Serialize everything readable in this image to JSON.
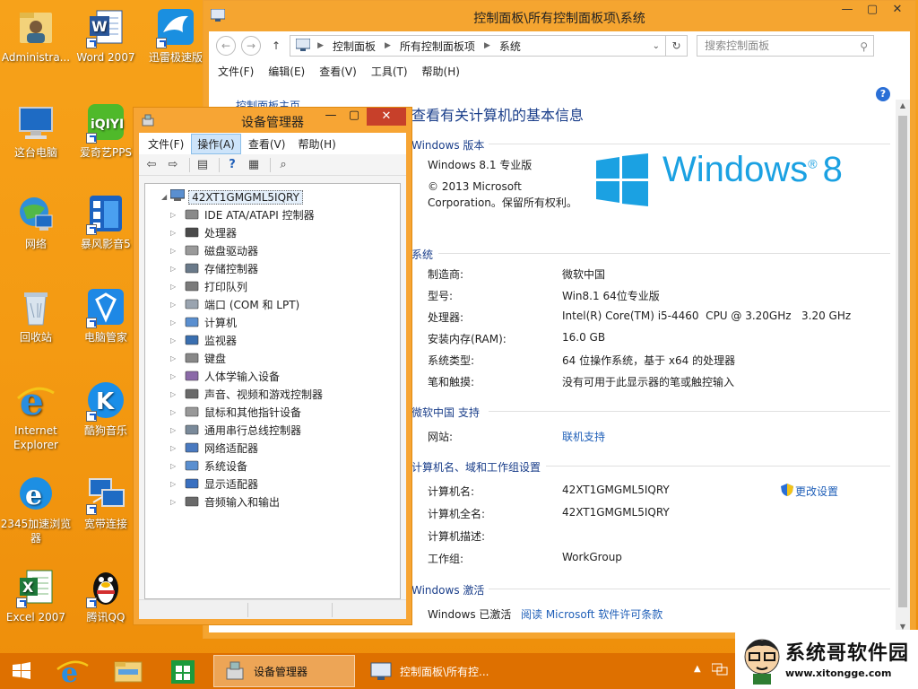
{
  "desktop": {
    "icons": [
      {
        "label": "Administra..."
      },
      {
        "label": "Word 2007"
      },
      {
        "label": "迅雷极速版"
      },
      {
        "label": "这台电脑"
      },
      {
        "label": "爱奇艺PPS"
      },
      {
        "label": "网络"
      },
      {
        "label": "暴风影音5"
      },
      {
        "label": "回收站"
      },
      {
        "label": "电脑管家"
      },
      {
        "label": "Internet Explorer"
      },
      {
        "label": "酷狗音乐"
      },
      {
        "label": "2345加速浏览器"
      },
      {
        "label": "宽带连接"
      },
      {
        "label": "Excel 2007"
      },
      {
        "label": "腾讯QQ"
      }
    ]
  },
  "control_panel": {
    "title": "控制面板\\所有控制面板项\\系统",
    "breadcrumbs": [
      "控制面板",
      "所有控制面板项",
      "系统"
    ],
    "search_placeholder": "搜索控制面板",
    "menu": [
      "文件(F)",
      "编辑(E)",
      "查看(V)",
      "工具(T)",
      "帮助(H)"
    ],
    "left_link": "控制面板主页",
    "heading": "查看有关计算机的基本信息",
    "edition": {
      "section": "Windows 版本",
      "name": "Windows 8.1 专业版",
      "copyright": "© 2013 Microsoft Corporation。保留所有权利。",
      "logo_text": "Windows",
      "logo_num": "8"
    },
    "system": {
      "section": "系统",
      "rows": [
        {
          "k": "制造商:",
          "v": "微软中国"
        },
        {
          "k": "型号:",
          "v": "Win8.1 64位专业版"
        },
        {
          "k": "处理器:",
          "v": "Intel(R) Core(TM) i5-4460  CPU @ 3.20GHz   3.20 GHz"
        },
        {
          "k": "安装内存(RAM):",
          "v": "16.0 GB"
        },
        {
          "k": "系统类型:",
          "v": "64 位操作系统，基于 x64 的处理器"
        },
        {
          "k": "笔和触摸:",
          "v": "没有可用于此显示器的笔或触控输入"
        }
      ]
    },
    "support": {
      "section": "微软中国 支持",
      "k": "网站:",
      "v": "联机支持"
    },
    "computer": {
      "section": "计算机名、域和工作组设置",
      "change": "更改设置",
      "rows": [
        {
          "k": "计算机名:",
          "v": "42XT1GMGML5IQRY"
        },
        {
          "k": "计算机全名:",
          "v": "42XT1GMGML5IQRY"
        },
        {
          "k": "计算机描述:",
          "v": ""
        },
        {
          "k": "工作组:",
          "v": "WorkGroup"
        }
      ]
    },
    "activation": {
      "section": "Windows 激活",
      "status": "Windows 已激活",
      "link": "阅读 Microsoft 软件许可条款"
    }
  },
  "device_manager": {
    "title": "设备管理器",
    "menu": [
      "文件(F)",
      "操作(A)",
      "查看(V)",
      "帮助(H)"
    ],
    "root": "42XT1GMGML5IQRY",
    "items": [
      "IDE ATA/ATAPI 控制器",
      "处理器",
      "磁盘驱动器",
      "存储控制器",
      "打印队列",
      "端口 (COM 和 LPT)",
      "计算机",
      "监视器",
      "键盘",
      "人体学输入设备",
      "声音、视频和游戏控制器",
      "鼠标和其他指针设备",
      "通用串行总线控制器",
      "网络适配器",
      "系统设备",
      "显示适配器",
      "音频输入和输出"
    ]
  },
  "taskbar": {
    "tasks": [
      "设备管理器",
      "控制面板\\所有控..."
    ]
  },
  "watermark": {
    "title": "系统哥软件园",
    "url": "www.xitongge.com"
  },
  "colors": {
    "desktop": "#f49a12",
    "accent_blue": "#1a3e8a",
    "link_blue": "#1f5fb8",
    "win8_blue": "#1ba1e2",
    "close_red": "#c7402a"
  }
}
